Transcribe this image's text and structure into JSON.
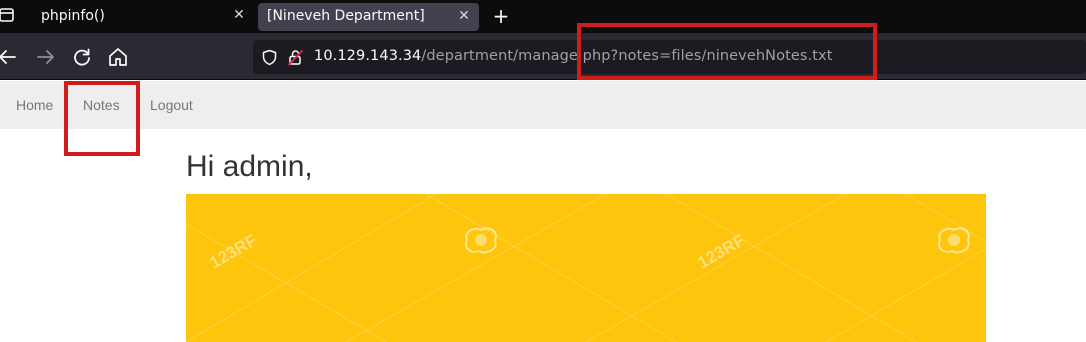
{
  "browser": {
    "tabs": [
      {
        "title": "phpinfo()",
        "active": false
      },
      {
        "title": "[Nineveh Department]",
        "active": true
      }
    ],
    "close_glyph": "✕",
    "new_tab_glyph": "+",
    "url": {
      "host": "10.129.143.34",
      "path": "/department/manage.php?notes=files/ninevehNotes.txt"
    },
    "icons": {
      "tab_menu": "tab-list-icon",
      "back": "back-arrow-icon",
      "forward": "forward-arrow-icon",
      "reload": "reload-icon",
      "home": "home-icon",
      "shield": "tracking-protection-icon",
      "lock": "insecure-lock-icon"
    }
  },
  "site_nav": {
    "items": [
      {
        "label": "Home"
      },
      {
        "label": "Notes"
      },
      {
        "label": "Logout"
      }
    ]
  },
  "page": {
    "greeting": "Hi admin,",
    "banner_color": "#fec50d",
    "watermark": "123RF"
  },
  "annotations": {
    "color": "#d11c1c"
  }
}
